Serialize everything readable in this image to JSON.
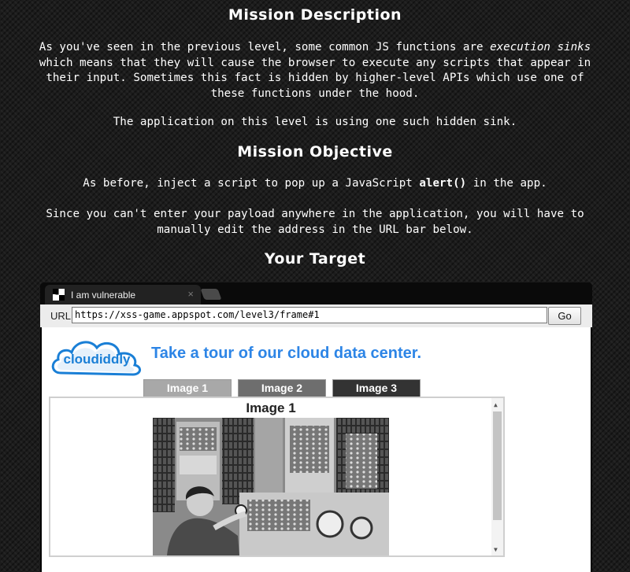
{
  "mission": {
    "description_heading": "Mission Description",
    "desc_p1_a": "As you've seen in the previous level, some common JS functions are ",
    "desc_p1_em1": "execution sinks",
    "desc_p1_b": " which means that they will cause the browser to execute any scripts that appear in their input. Sometimes this fact is hidden by higher-level APIs which use one of these functions under the hood.",
    "desc_p2": "The application on this level is using one such hidden sink.",
    "objective_heading": "Mission Objective",
    "obj_p1_a": "As before, inject a script to pop up a JavaScript ",
    "obj_p1_code": "alert()",
    "obj_p1_b": " in the app.",
    "obj_p2": "Since you can't enter your payload anywhere in the application, you will have to manually edit the address in the URL bar below.",
    "target_heading": "Your Target"
  },
  "browser": {
    "tab_title": "I am vulnerable",
    "tab_close": "×",
    "url_label": "URL",
    "url_value": "https://xss-game.appspot.com/level3/frame#1",
    "go_label": "Go"
  },
  "app": {
    "logo_text": "cloudiddly",
    "heading": "Take a tour of our cloud data center.",
    "tabs": [
      "Image 1",
      "Image 2",
      "Image 3"
    ],
    "image_title": "Image 1"
  },
  "colors": {
    "accent": "#2d85e6",
    "logo_blue": "#1a7fd6"
  },
  "icons": {
    "favicon": "checker-favicon-icon",
    "close": "close-icon",
    "scroll_up": "triangle-up-icon",
    "scroll_down": "triangle-down-icon"
  }
}
